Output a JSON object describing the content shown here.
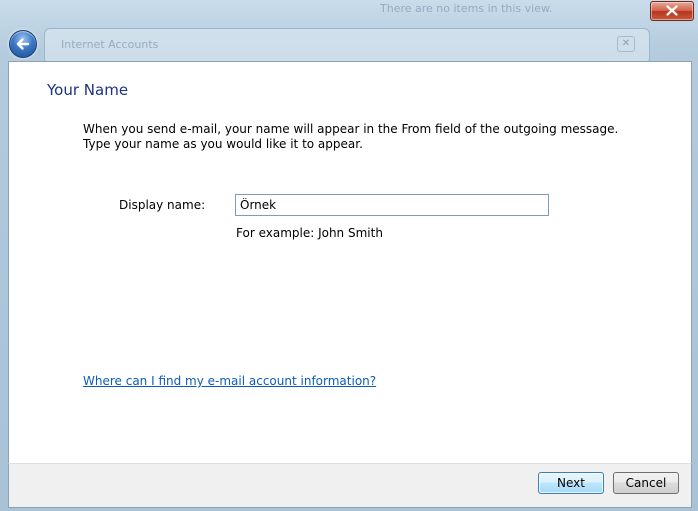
{
  "background": {
    "ghost_title": "There are no items in this view.",
    "ghost_window_title": "Internet Accounts"
  },
  "titlebar": {
    "close_icon": "close-icon",
    "back_icon": "back-arrow-icon"
  },
  "wizard": {
    "title": "Your Name",
    "instruction_line1": "When you send e-mail, your name will appear in the From field of the outgoing message.",
    "instruction_line2": "Type your name as you would like it to appear.",
    "display_name_label": "Display name:",
    "display_name_value": "Örnek",
    "example_text": "For example: John Smith",
    "help_link": "Where can I find my e-mail account information?"
  },
  "footer": {
    "next_label": "Next",
    "cancel_label": "Cancel"
  },
  "colors": {
    "title": "#1e3287",
    "link": "#0d5cb8",
    "frame": "#aec6d9",
    "close_button": "#c9583c"
  }
}
